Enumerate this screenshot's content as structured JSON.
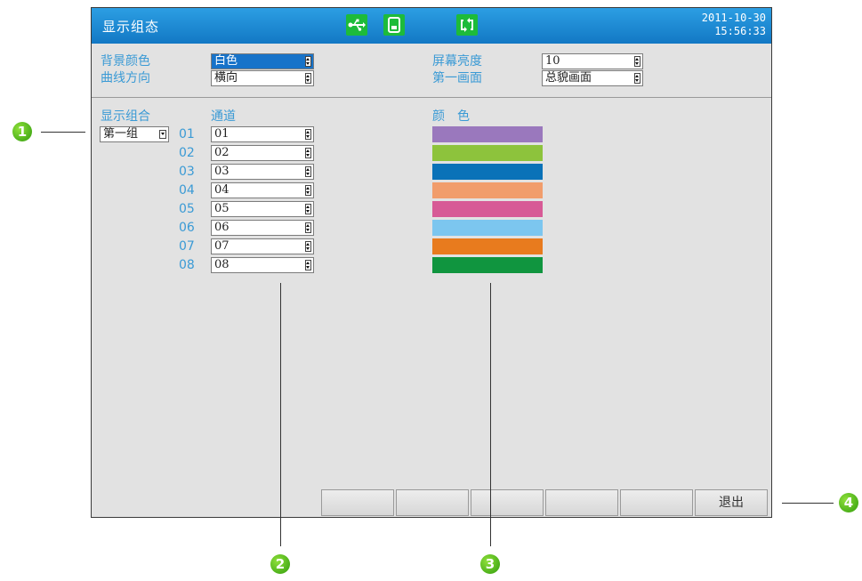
{
  "titlebar": {
    "title": "显示组态",
    "date": "2011-10-30",
    "time": "15:56:33",
    "icons": [
      "usb-icon",
      "sd-card-icon",
      "refresh-icon"
    ]
  },
  "top_settings": {
    "bg_color": {
      "label": "背景颜色",
      "value": "白色"
    },
    "curve_direction": {
      "label": "曲线方向",
      "value": "横向"
    },
    "brightness": {
      "label": "屏幕亮度",
      "value": "10"
    },
    "first_screen": {
      "label": "第一画面",
      "value": "总貌画面"
    }
  },
  "group": {
    "label": "显示组合",
    "value": "第一组"
  },
  "channels": {
    "header": "通道",
    "items": [
      {
        "num": "01",
        "value": "01"
      },
      {
        "num": "02",
        "value": "02"
      },
      {
        "num": "03",
        "value": "03"
      },
      {
        "num": "04",
        "value": "04"
      },
      {
        "num": "05",
        "value": "05"
      },
      {
        "num": "06",
        "value": "06"
      },
      {
        "num": "07",
        "value": "07"
      },
      {
        "num": "08",
        "value": "08"
      }
    ]
  },
  "colors": {
    "header": "颜　色",
    "swatches": [
      "#9a78bd",
      "#8dc33c",
      "#0a72b8",
      "#f19d6c",
      "#d75a96",
      "#7cc6ef",
      "#e87b1e",
      "#10953f"
    ]
  },
  "bottom_buttons": [
    "",
    "",
    "",
    "",
    "",
    "退出"
  ],
  "callouts": [
    "1",
    "2",
    "3",
    "4"
  ],
  "theme": {
    "accent": "#1a87d0",
    "label_color": "#3a9ad5",
    "icon_green": "#1dbb3a",
    "callout_green": "#5cbf24"
  }
}
